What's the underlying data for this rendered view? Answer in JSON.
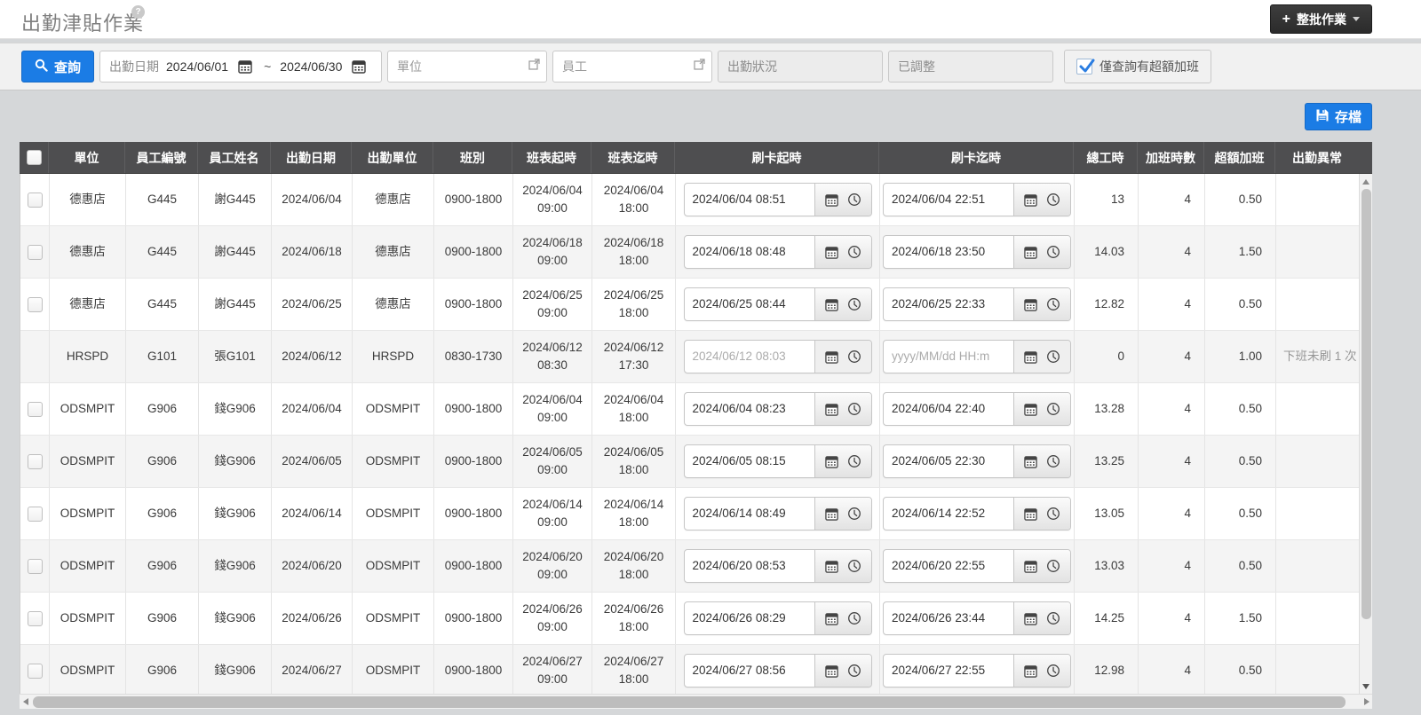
{
  "header": {
    "title": "出勤津貼作業",
    "help_icon": "question-mark",
    "batch_button_label": "整批作業",
    "batch_button_plus": "+"
  },
  "filters": {
    "search_button_label": "查詢",
    "date_label": "出勤日期",
    "date_from": "2024/06/01",
    "date_separator": "~",
    "date_to": "2024/06/30",
    "unit_placeholder": "單位",
    "employee_placeholder": "員工",
    "status_placeholder": "出勤狀況",
    "adjusted_placeholder": "已調整",
    "overtime_only_label": "僅查詢有超額加班",
    "overtime_only_checked": true
  },
  "toolbar": {
    "save_label": "存檔"
  },
  "colors": {
    "accent_blue": "#1b7ce5",
    "header_dark": "#4e4e50",
    "row_alt": "#f4f4f4"
  },
  "icons": {
    "search": "magnifier",
    "calendar": "calendar-grid",
    "clock": "clock-face",
    "save": "floppy-disk",
    "lookup": "open-popup-window",
    "check": "blue-checkmark",
    "caret": "caret-down"
  },
  "table": {
    "columns": [
      "單位",
      "員工編號",
      "員工姓名",
      "出勤日期",
      "出勤單位",
      "班別",
      "班表起時",
      "班表迄時",
      "刷卡起時",
      "刷卡迄時",
      "總工時",
      "加班時數",
      "超額加班",
      "出勤異常"
    ],
    "datetime_placeholder": "yyyy/MM/dd HH:m",
    "rows": [
      {
        "checkbox": true,
        "unit": "德惠店",
        "emp_id": "G445",
        "emp_name": "謝G445",
        "date": "2024/06/04",
        "att_unit": "德惠店",
        "shift": "0900-1800",
        "sched_start": "2024/06/04 09:00",
        "sched_end": "2024/06/04 18:00",
        "card_start": "2024/06/04 08:51",
        "card_end": "2024/06/04 22:51",
        "disabled": false,
        "total_hours": "13",
        "overtime_hours": "4",
        "excess_overtime": "0.50",
        "abnormal": ""
      },
      {
        "checkbox": true,
        "unit": "德惠店",
        "emp_id": "G445",
        "emp_name": "謝G445",
        "date": "2024/06/18",
        "att_unit": "德惠店",
        "shift": "0900-1800",
        "sched_start": "2024/06/18 09:00",
        "sched_end": "2024/06/18 18:00",
        "card_start": "2024/06/18 08:48",
        "card_end": "2024/06/18 23:50",
        "disabled": false,
        "total_hours": "14.03",
        "overtime_hours": "4",
        "excess_overtime": "1.50",
        "abnormal": ""
      },
      {
        "checkbox": true,
        "unit": "德惠店",
        "emp_id": "G445",
        "emp_name": "謝G445",
        "date": "2024/06/25",
        "att_unit": "德惠店",
        "shift": "0900-1800",
        "sched_start": "2024/06/25 09:00",
        "sched_end": "2024/06/25 18:00",
        "card_start": "2024/06/25 08:44",
        "card_end": "2024/06/25 22:33",
        "disabled": false,
        "total_hours": "12.82",
        "overtime_hours": "4",
        "excess_overtime": "0.50",
        "abnormal": ""
      },
      {
        "checkbox": false,
        "unit": "HRSPD",
        "emp_id": "G101",
        "emp_name": "張G101",
        "date": "2024/06/12",
        "att_unit": "HRSPD",
        "shift": "0830-1730",
        "sched_start": "2024/06/12 08:30",
        "sched_end": "2024/06/12 17:30",
        "card_start": "2024/06/12 08:03",
        "card_end": "",
        "disabled": true,
        "total_hours": "0",
        "overtime_hours": "4",
        "excess_overtime": "1.00",
        "abnormal": "下班未刷 1 次"
      },
      {
        "checkbox": true,
        "unit": "ODSMPIT",
        "emp_id": "G906",
        "emp_name": "錢G906",
        "date": "2024/06/04",
        "att_unit": "ODSMPIT",
        "shift": "0900-1800",
        "sched_start": "2024/06/04 09:00",
        "sched_end": "2024/06/04 18:00",
        "card_start": "2024/06/04 08:23",
        "card_end": "2024/06/04 22:40",
        "disabled": false,
        "total_hours": "13.28",
        "overtime_hours": "4",
        "excess_overtime": "0.50",
        "abnormal": ""
      },
      {
        "checkbox": true,
        "unit": "ODSMPIT",
        "emp_id": "G906",
        "emp_name": "錢G906",
        "date": "2024/06/05",
        "att_unit": "ODSMPIT",
        "shift": "0900-1800",
        "sched_start": "2024/06/05 09:00",
        "sched_end": "2024/06/05 18:00",
        "card_start": "2024/06/05 08:15",
        "card_end": "2024/06/05 22:30",
        "disabled": false,
        "total_hours": "13.25",
        "overtime_hours": "4",
        "excess_overtime": "0.50",
        "abnormal": ""
      },
      {
        "checkbox": true,
        "unit": "ODSMPIT",
        "emp_id": "G906",
        "emp_name": "錢G906",
        "date": "2024/06/14",
        "att_unit": "ODSMPIT",
        "shift": "0900-1800",
        "sched_start": "2024/06/14 09:00",
        "sched_end": "2024/06/14 18:00",
        "card_start": "2024/06/14 08:49",
        "card_end": "2024/06/14 22:52",
        "disabled": false,
        "total_hours": "13.05",
        "overtime_hours": "4",
        "excess_overtime": "0.50",
        "abnormal": ""
      },
      {
        "checkbox": true,
        "unit": "ODSMPIT",
        "emp_id": "G906",
        "emp_name": "錢G906",
        "date": "2024/06/20",
        "att_unit": "ODSMPIT",
        "shift": "0900-1800",
        "sched_start": "2024/06/20 09:00",
        "sched_end": "2024/06/20 18:00",
        "card_start": "2024/06/20 08:53",
        "card_end": "2024/06/20 22:55",
        "disabled": false,
        "total_hours": "13.03",
        "overtime_hours": "4",
        "excess_overtime": "0.50",
        "abnormal": ""
      },
      {
        "checkbox": true,
        "unit": "ODSMPIT",
        "emp_id": "G906",
        "emp_name": "錢G906",
        "date": "2024/06/26",
        "att_unit": "ODSMPIT",
        "shift": "0900-1800",
        "sched_start": "2024/06/26 09:00",
        "sched_end": "2024/06/26 18:00",
        "card_start": "2024/06/26 08:29",
        "card_end": "2024/06/26 23:44",
        "disabled": false,
        "total_hours": "14.25",
        "overtime_hours": "4",
        "excess_overtime": "1.50",
        "abnormal": ""
      },
      {
        "checkbox": true,
        "unit": "ODSMPIT",
        "emp_id": "G906",
        "emp_name": "錢G906",
        "date": "2024/06/27",
        "att_unit": "ODSMPIT",
        "shift": "0900-1800",
        "sched_start": "2024/06/27 09:00",
        "sched_end": "2024/06/27 18:00",
        "card_start": "2024/06/27 08:56",
        "card_end": "2024/06/27 22:55",
        "disabled": false,
        "total_hours": "12.98",
        "overtime_hours": "4",
        "excess_overtime": "0.50",
        "abnormal": ""
      }
    ]
  }
}
